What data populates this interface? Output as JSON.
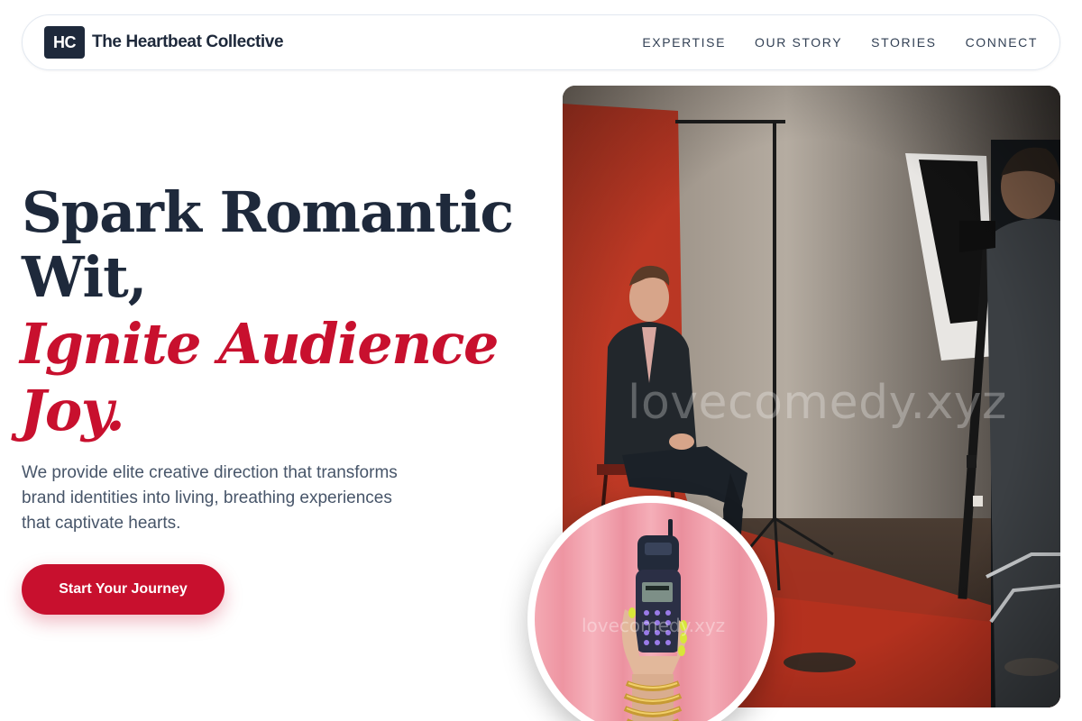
{
  "brand": {
    "logo_text": "HC",
    "name": "The Heartbeat Collective"
  },
  "nav": {
    "links": [
      "EXPERTISE",
      "OUR STORY",
      "STORIES",
      "CONNECT"
    ]
  },
  "hero": {
    "headline_line1": "Spark Romantic",
    "headline_line2": "Wit,",
    "accent_line1": "Ignite Audience",
    "accent_line2": "Joy.",
    "subtext": "We provide elite creative direction that transforms brand identities into living, breathing experiences that captivate hearts.",
    "cta_label": "Start Your Journey"
  },
  "media": {
    "main_watermark": "lovecomedy.xyz",
    "inset_watermark": "lovecomedy.xyz"
  },
  "colors": {
    "primary_dark": "#1e293b",
    "accent_red": "#c8102e",
    "muted_text": "#475569",
    "nav_border": "#e2e8f0"
  }
}
